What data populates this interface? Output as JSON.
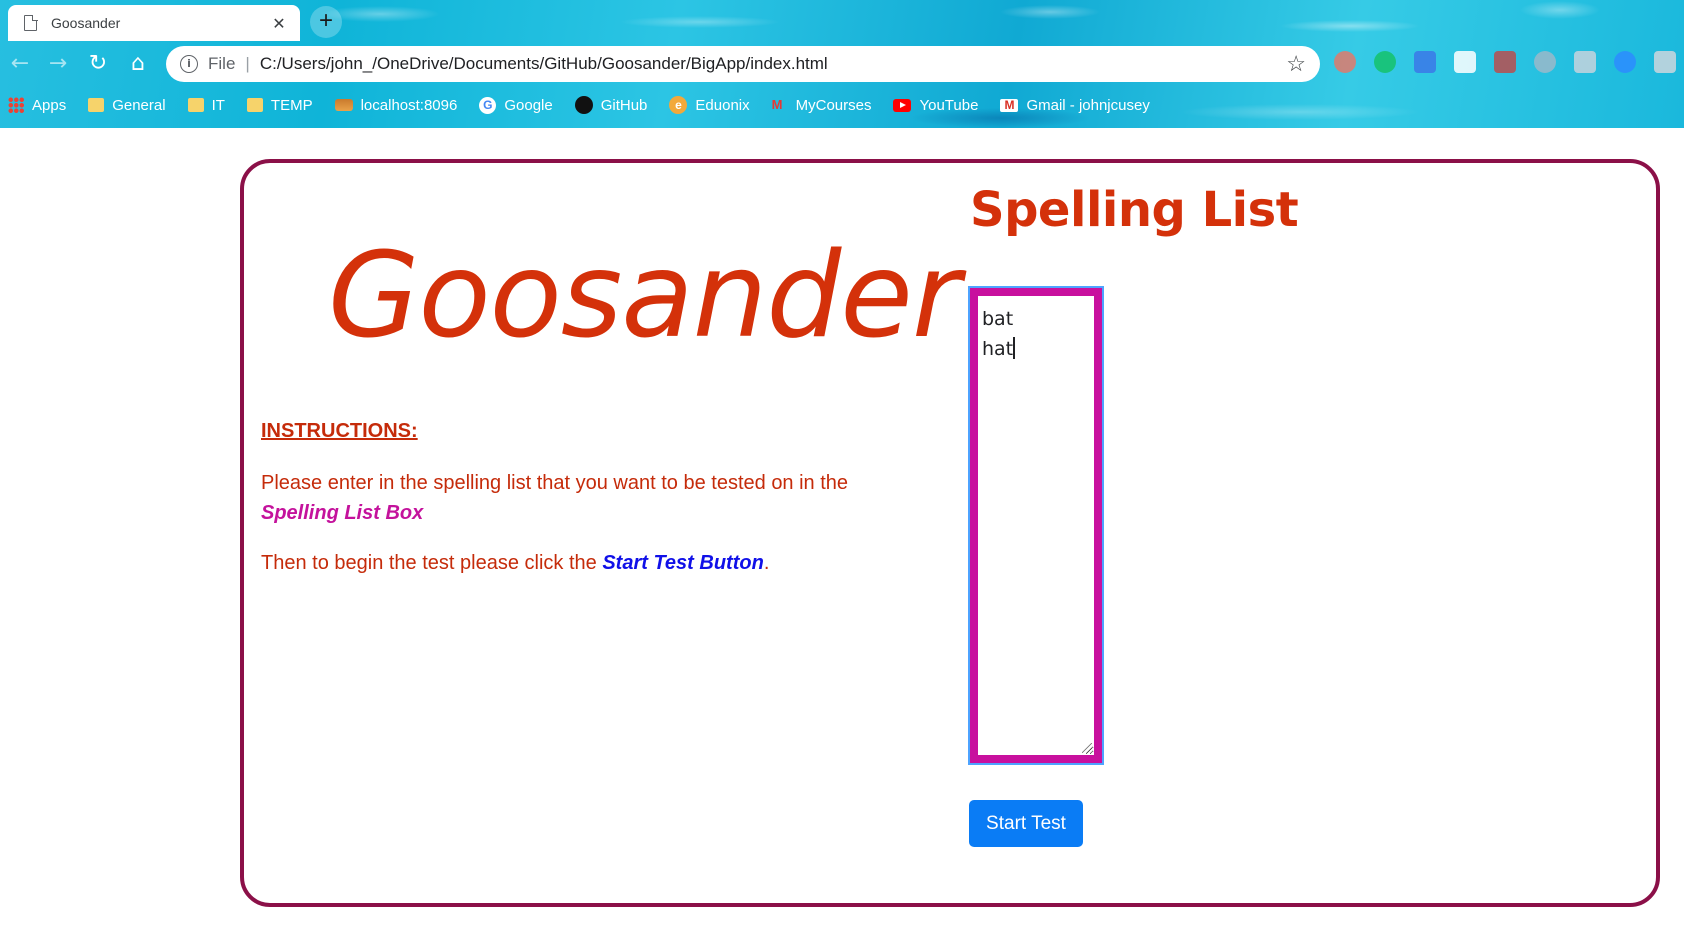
{
  "browser": {
    "tab_title": "Goosander",
    "tab_close": "✕",
    "new_tab": "+",
    "url_prefix": "File",
    "url": "C:/Users/john_/OneDrive/Documents/GitHub/Goosander/BigApp/index.html",
    "bookmarks": [
      "Apps",
      "General",
      "IT",
      "TEMP",
      "localhost:8096",
      "Google",
      "GitHub",
      "Eduonix",
      "MyCourses",
      "YouTube",
      "Gmail - johnjcusey"
    ]
  },
  "page": {
    "brand": "Goosander",
    "instructions_heading": "INSTRUCTIONS:",
    "instruction_1_text": "Please enter in the spelling list that you want to be tested on in the ",
    "instruction_1_highlight": "Spelling List Box",
    "instruction_2_text": "Then to begin the test please click the ",
    "instruction_2_highlight": "Start Test Button",
    "instruction_2_end": ".",
    "list_title": "Spelling List",
    "spelling_words": [
      "bat",
      "hat"
    ],
    "start_button": "Start Test"
  },
  "colors": {
    "accent_red": "#d4310a",
    "highlight_pink": "#c4129c",
    "highlight_blue": "#1010e8",
    "button_blue": "#0a7cf5",
    "card_border": "#8b1048"
  }
}
